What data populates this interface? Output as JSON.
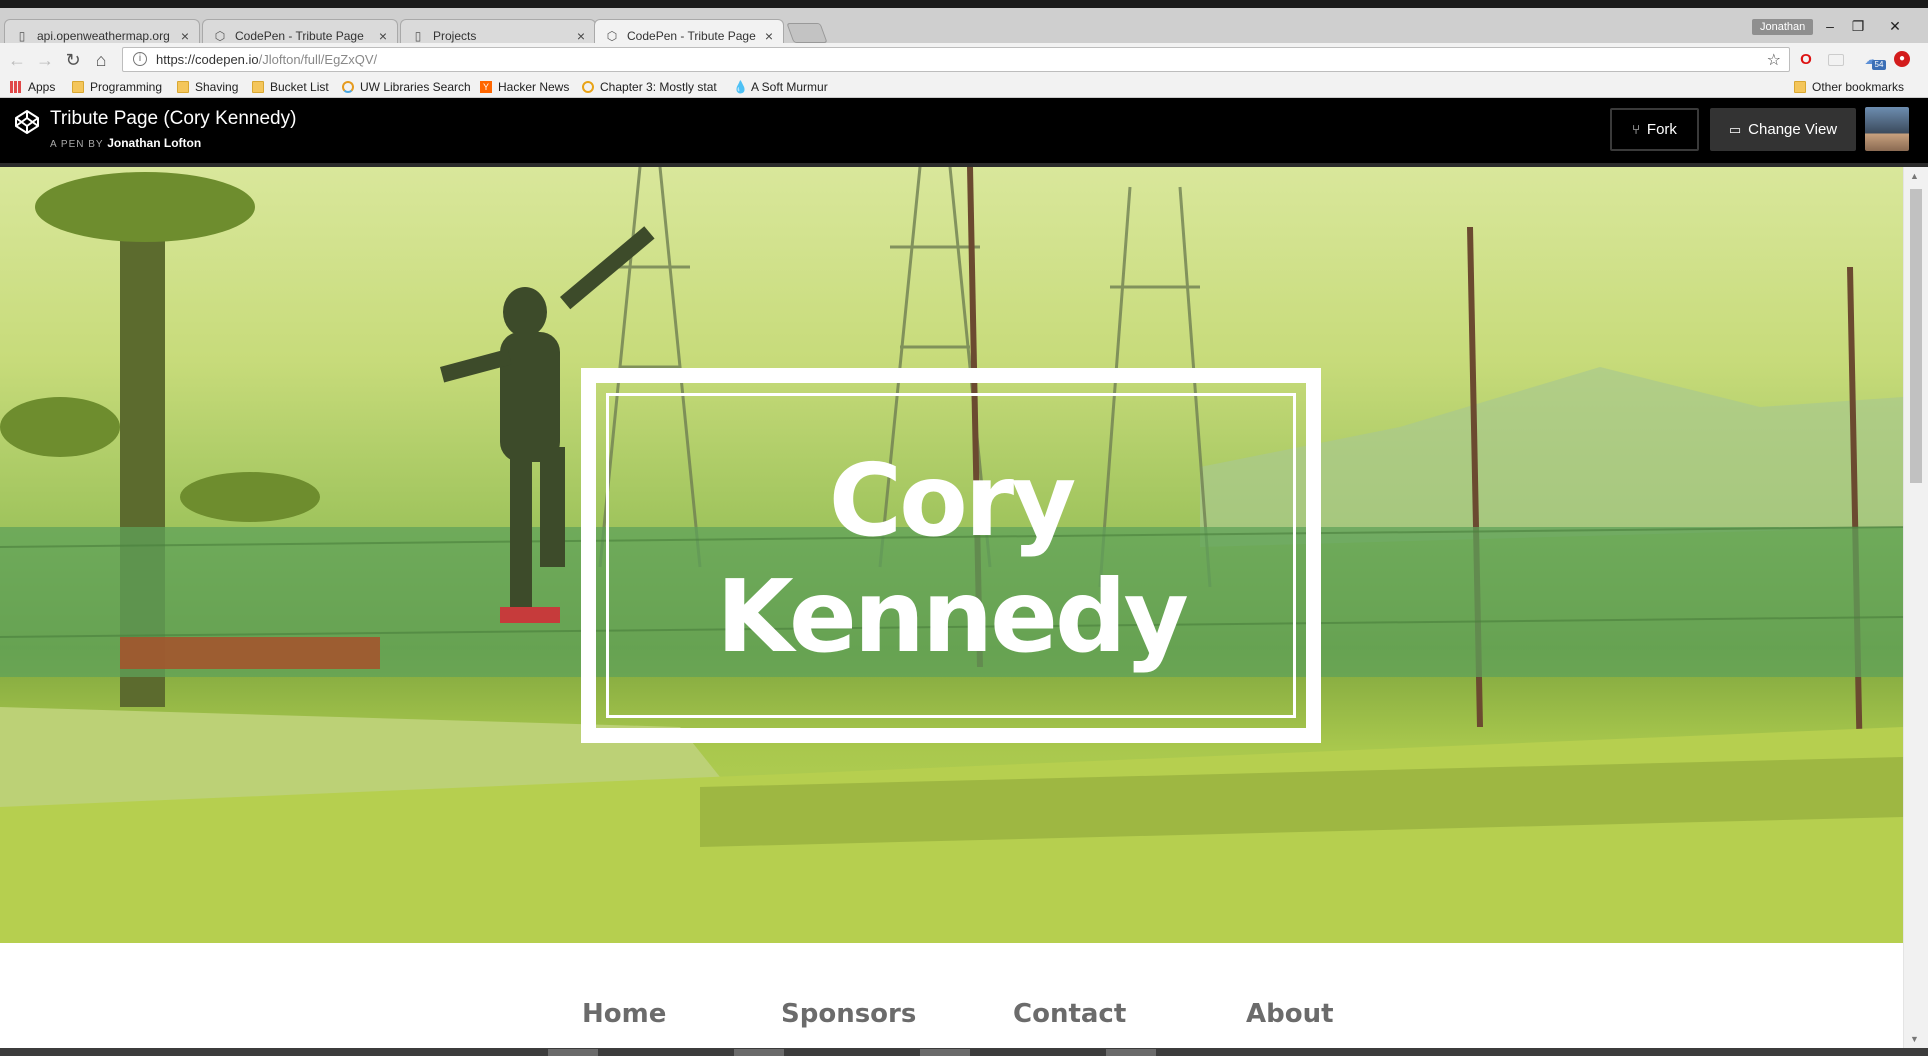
{
  "browser": {
    "tabs": [
      {
        "title": "api.openweathermap.org",
        "icon": "page-icon"
      },
      {
        "title": "CodePen - Tribute Page",
        "icon": "codepen-icon"
      },
      {
        "title": "Projects",
        "icon": "page-icon"
      },
      {
        "title": "CodePen - Tribute Page",
        "icon": "codepen-icon",
        "active": true
      }
    ],
    "profile_name": "Jonathan",
    "url_host": "https://codepen.io",
    "url_path": "/Jlofton/full/EgZxQV/",
    "extension_badge": "54",
    "bookmarks": [
      {
        "label": "Apps",
        "icon": "apps-grid-icon"
      },
      {
        "label": "Programming",
        "icon": "folder-icon"
      },
      {
        "label": "Shaving",
        "icon": "folder-icon"
      },
      {
        "label": "Bucket List",
        "icon": "folder-icon"
      },
      {
        "label": "UW Libraries Search",
        "icon": "uw-icon"
      },
      {
        "label": "Hacker News",
        "icon": "hacker-news-icon"
      },
      {
        "label": "Chapter 3: Mostly stat",
        "icon": "chapter-icon"
      },
      {
        "label": "A Soft Murmur",
        "icon": "droplet-icon"
      },
      {
        "label": "Other bookmarks",
        "icon": "folder-icon"
      }
    ]
  },
  "codepen": {
    "title": "Tribute Page (Cory Kennedy)",
    "byline_prefix": "A PEN BY",
    "author": "Jonathan Lofton",
    "fork_label": "Fork",
    "change_view_label": "Change View"
  },
  "page": {
    "hero_name_line1": "Cory",
    "hero_name_line2": "Kennedy",
    "nav": [
      "Home",
      "Sponsors",
      "Contact",
      "About"
    ]
  },
  "colors": {
    "header_bg": "#000000",
    "hero_tint": "#c7db7a",
    "nav_text": "#6b6b6b"
  }
}
